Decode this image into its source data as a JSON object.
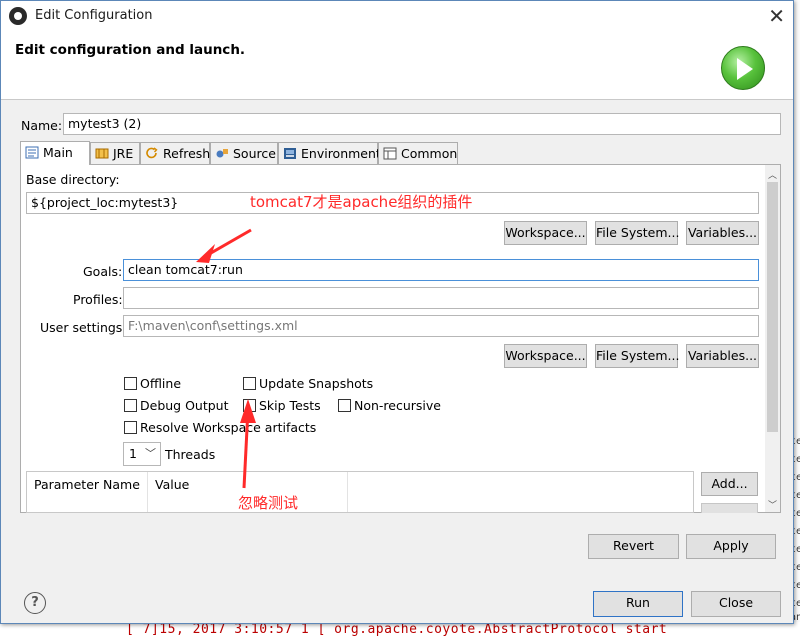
{
  "dialog": {
    "title": "Edit Configuration",
    "close_glyph": "✕",
    "heading": "Edit configuration and launch."
  },
  "name": {
    "label": "Name:",
    "value": "mytest3 (2)"
  },
  "tabs": [
    {
      "label": "Main",
      "icon": "main-tab-icon",
      "active": true
    },
    {
      "label": "JRE",
      "icon": "jre-icon"
    },
    {
      "label": "Refresh",
      "icon": "refresh-icon"
    },
    {
      "label": "Source",
      "icon": "source-icon"
    },
    {
      "label": "Environment",
      "icon": "environment-icon"
    },
    {
      "label": "Common",
      "icon": "common-icon"
    }
  ],
  "main": {
    "base_directory": {
      "label": "Base directory:",
      "value": "${project_loc:mytest3}"
    },
    "buttons_row1": {
      "workspace": "Workspace...",
      "file_system": "File System...",
      "variables": "Variables..."
    },
    "goals": {
      "label": "Goals:",
      "value": "clean tomcat7:run"
    },
    "profiles": {
      "label": "Profiles:",
      "value": ""
    },
    "user_settings": {
      "label": "User settings:",
      "value": "F:\\maven\\conf\\settings.xml"
    },
    "buttons_row2": {
      "workspace": "Workspace...",
      "file_system": "File System...",
      "variables": "Variables..."
    },
    "checkboxes": {
      "offline": "Offline",
      "update_snapshots": "Update Snapshots",
      "debug_output": "Debug Output",
      "skip_tests": "Skip Tests",
      "non_recursive": "Non-recursive",
      "resolve_workspace": "Resolve Workspace artifacts"
    },
    "threads": {
      "value": "1",
      "label": "Threads"
    },
    "parameters": {
      "columns": [
        "Parameter Name",
        "Value"
      ],
      "add_button": "Add..."
    }
  },
  "actions": {
    "revert": "Revert",
    "apply": "Apply",
    "run": "Run",
    "close": "Close"
  },
  "annotations": {
    "goal_note": "tomcat7才是apache组织的插件",
    "skip_note": "忽略测试",
    "color": "#ff2a2a"
  },
  "background": {
    "console_line": "[ 7]15, 2017 3:10:57 1 [ org.apache.coyote.AbstractProtocol start",
    "right_gutter": [
      "te",
      "te",
      "te",
      "te",
      "te",
      "te",
      "te",
      "te",
      "te",
      "te",
      "te",
      "an"
    ]
  }
}
